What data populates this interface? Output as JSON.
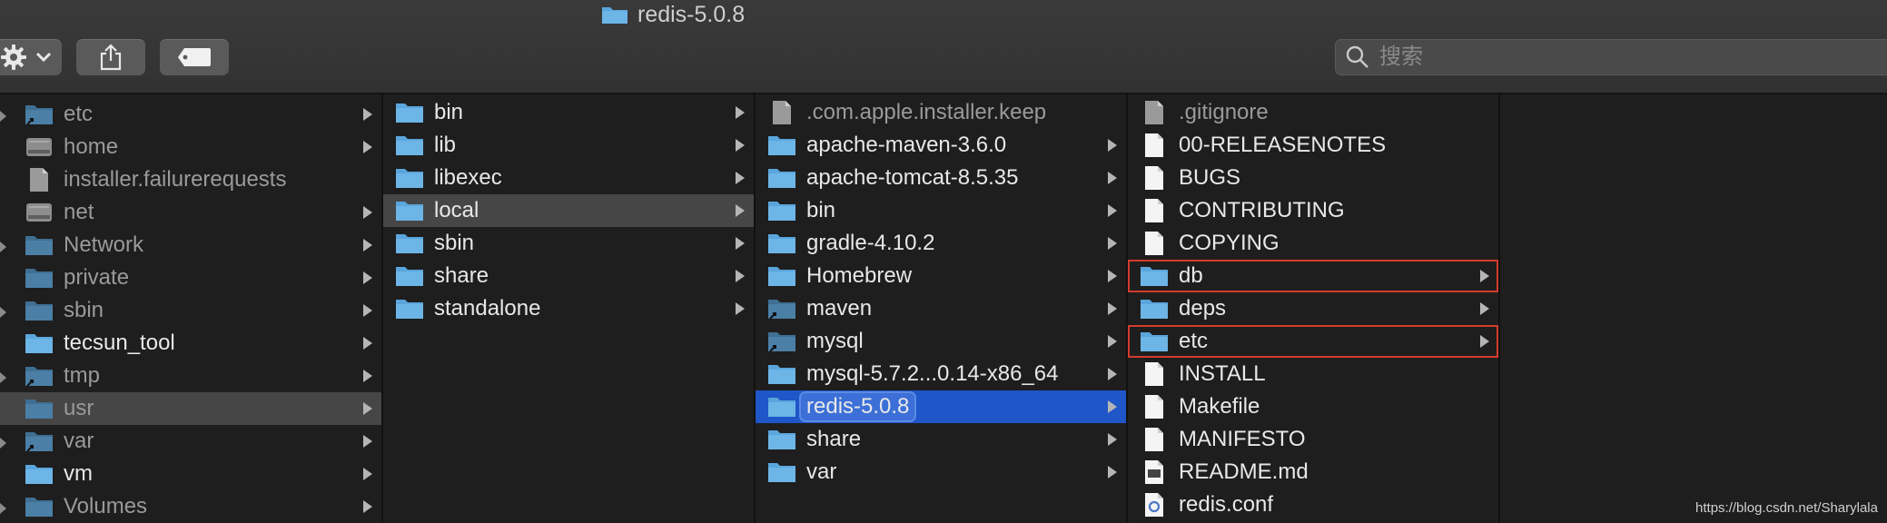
{
  "window": {
    "title": "redis-5.0.8"
  },
  "toolbar": {
    "search_placeholder": "搜索",
    "icons": [
      "gear-icon",
      "chevron-down-icon",
      "share-icon",
      "tag-icon",
      "search-icon"
    ]
  },
  "colors": {
    "folder": "#5aa6dc",
    "selection_blue": "#1f56c8",
    "selection_gray": "#464646",
    "red_box": "#d33b2c"
  },
  "columns": [
    {
      "items": [
        {
          "label": "etc",
          "icon": "alias-folder",
          "chevron": true
        },
        {
          "label": "home",
          "icon": "disk",
          "chevron": true
        },
        {
          "label": "installer.failurerequests",
          "icon": "file-gray",
          "chevron": false
        },
        {
          "label": "net",
          "icon": "disk",
          "chevron": true
        },
        {
          "label": "Network",
          "icon": "folder-dim",
          "chevron": true
        },
        {
          "label": "private",
          "icon": "folder-dim",
          "chevron": true
        },
        {
          "label": "sbin",
          "icon": "folder-dim",
          "chevron": true
        },
        {
          "label": "tecsun_tool",
          "icon": "folder",
          "chevron": true
        },
        {
          "label": "tmp",
          "icon": "alias-folder",
          "chevron": true
        },
        {
          "label": "usr",
          "icon": "folder-dim",
          "chevron": true
        },
        {
          "label": "var",
          "icon": "alias-folder",
          "chevron": true
        },
        {
          "label": "vm",
          "icon": "folder",
          "chevron": true
        },
        {
          "label": "Volumes",
          "icon": "folder-dim",
          "chevron": true
        }
      ]
    },
    {
      "items": [
        {
          "label": "bin",
          "icon": "folder",
          "chevron": true
        },
        {
          "label": "lib",
          "icon": "folder",
          "chevron": true
        },
        {
          "label": "libexec",
          "icon": "folder",
          "chevron": true
        },
        {
          "label": "local",
          "icon": "folder",
          "chevron": true
        },
        {
          "label": "sbin",
          "icon": "folder",
          "chevron": true
        },
        {
          "label": "share",
          "icon": "folder",
          "chevron": true
        },
        {
          "label": "standalone",
          "icon": "folder",
          "chevron": true
        }
      ]
    },
    {
      "items": [
        {
          "label": ".com.apple.installer.keep",
          "icon": "file-gray",
          "chevron": false
        },
        {
          "label": "apache-maven-3.6.0",
          "icon": "folder",
          "chevron": true
        },
        {
          "label": "apache-tomcat-8.5.35",
          "icon": "folder",
          "chevron": true
        },
        {
          "label": "bin",
          "icon": "folder",
          "chevron": true
        },
        {
          "label": "gradle-4.10.2",
          "icon": "folder",
          "chevron": true
        },
        {
          "label": "Homebrew",
          "icon": "folder",
          "chevron": true
        },
        {
          "label": "maven",
          "icon": "alias-folder",
          "chevron": true
        },
        {
          "label": "mysql",
          "icon": "alias-folder",
          "chevron": true
        },
        {
          "label": "mysql-5.7.2...0.14-x86_64",
          "icon": "folder",
          "chevron": true
        },
        {
          "label": "redis-5.0.8",
          "icon": "folder",
          "chevron": true
        },
        {
          "label": "share",
          "icon": "folder",
          "chevron": true
        },
        {
          "label": "var",
          "icon": "folder",
          "chevron": true
        }
      ]
    },
    {
      "items": [
        {
          "label": ".gitignore",
          "icon": "file-gray",
          "chevron": false
        },
        {
          "label": "00-RELEASENOTES",
          "icon": "file",
          "chevron": false
        },
        {
          "label": "BUGS",
          "icon": "file",
          "chevron": false
        },
        {
          "label": "CONTRIBUTING",
          "icon": "file",
          "chevron": false
        },
        {
          "label": "COPYING",
          "icon": "file",
          "chevron": false
        },
        {
          "label": "db",
          "icon": "folder",
          "chevron": true
        },
        {
          "label": "deps",
          "icon": "folder",
          "chevron": true
        },
        {
          "label": "etc",
          "icon": "folder",
          "chevron": true
        },
        {
          "label": "INSTALL",
          "icon": "file",
          "chevron": false
        },
        {
          "label": "Makefile",
          "icon": "file",
          "chevron": false
        },
        {
          "label": "MANIFESTO",
          "icon": "file",
          "chevron": false
        },
        {
          "label": "README.md",
          "icon": "file-md",
          "chevron": false
        },
        {
          "label": "redis.conf",
          "icon": "file-conf",
          "chevron": false
        }
      ]
    }
  ],
  "selection": {
    "col1": "usr",
    "col2": "local",
    "col3": "redis-5.0.8",
    "highlighted_col4": [
      "db",
      "etc"
    ]
  },
  "watermark": "https://blog.csdn.net/Sharylala"
}
